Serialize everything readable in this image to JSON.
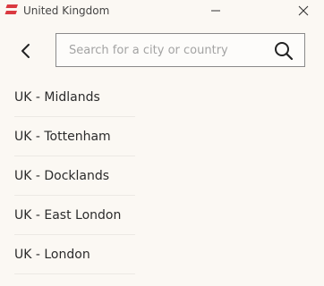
{
  "window": {
    "title": "United Kingdom",
    "icons": {
      "logo": "expressvpn-logo-icon",
      "minimize": "minimize-icon",
      "close": "close-icon"
    }
  },
  "header": {
    "back_icon": "chevron-left-icon",
    "search": {
      "placeholder": "Search for a city or country",
      "value": "",
      "icon": "search-icon"
    }
  },
  "locations": [
    {
      "label": "UK - Midlands"
    },
    {
      "label": "UK - Tottenham"
    },
    {
      "label": "UK - Docklands"
    },
    {
      "label": "UK - East London"
    },
    {
      "label": "UK - London"
    }
  ],
  "colors": {
    "brand": "#da3940",
    "background": "#fbf8f3",
    "border": "#8a8a8a"
  }
}
